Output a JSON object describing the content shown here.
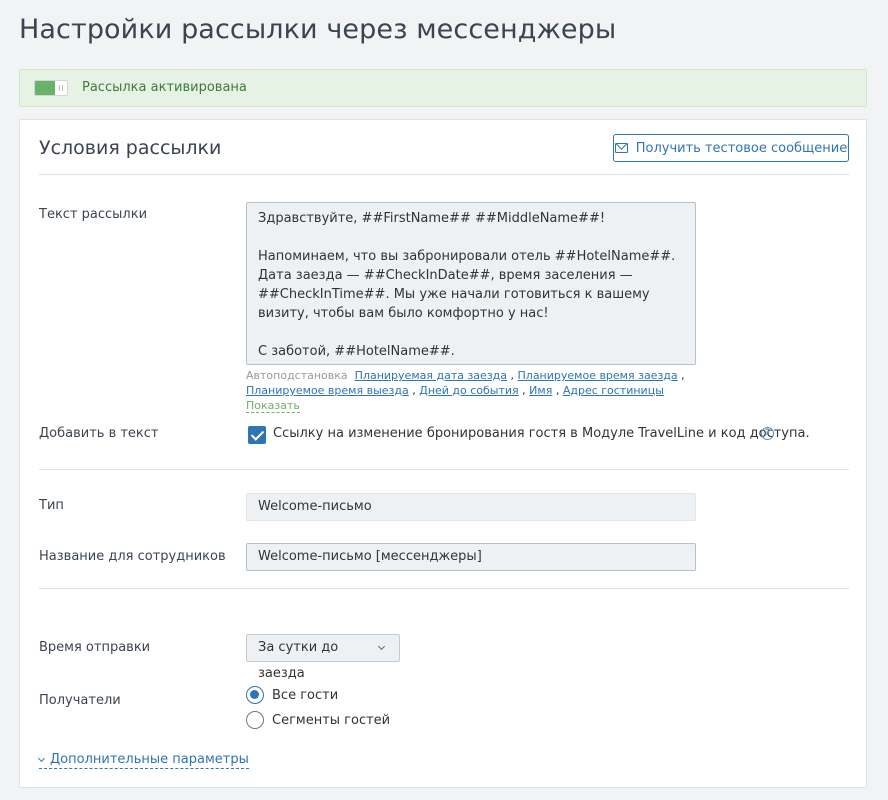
{
  "page": {
    "title": "Настройки рассылки через мессенджеры"
  },
  "status": {
    "text": "Рассылка активирована",
    "enabled": true
  },
  "conditions": {
    "title": "Условия рассылки",
    "test_button": "Получить тестовое сообщение"
  },
  "message": {
    "label": "Текст рассылки",
    "text": "Здравствуйте, ##FirstName## ##MiddleName##!\n\nНапоминаем, что вы забронировали отель ##HotelName##. Дата заезда — ##CheckInDate##, время заселения — ##CheckInTime##. Мы уже начали готовиться к вашему визиту, чтобы вам было комфортно у нас!\n\nС заботой, ##HotelName##.",
    "autosubst_label": "Автоподстановка",
    "autosubst_links": [
      "Планируемая дата заезда",
      "Планируемое время заезда",
      "Планируемое время выезда",
      "Дней до события",
      "Имя",
      "Адрес гостиницы"
    ],
    "show_link": "Показать"
  },
  "add_to_text": {
    "label": "Добавить в текст",
    "checkbox_label": "Ссылку на изменение бронирования гостя в Модуле TravelLine и код доступа.",
    "checked": true
  },
  "type": {
    "label": "Тип",
    "value": "Welcome-письмо"
  },
  "staff_name": {
    "label": "Название для сотрудников",
    "value": "Welcome-письмо [мессенджеры]"
  },
  "send_time": {
    "label": "Время отправки",
    "value": "За сутки до заезда"
  },
  "recipients": {
    "label": "Получатели",
    "options": [
      "Все гости",
      "Сегменты гостей"
    ],
    "selected": 0
  },
  "extra": {
    "label": "Дополнительные параметры"
  },
  "colors": {
    "accent": "#2f74b5",
    "success": "#6ab267",
    "success_bg": "#e6f3e4"
  }
}
